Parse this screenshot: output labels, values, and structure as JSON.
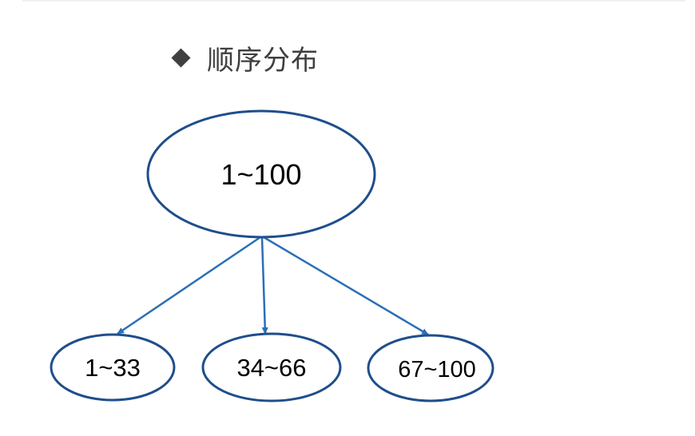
{
  "title": "顺序分布",
  "diagram": {
    "root": {
      "label": "1~100"
    },
    "children": [
      {
        "label": "1~33"
      },
      {
        "label": "34~66"
      },
      {
        "label": "67~100"
      }
    ],
    "colors": {
      "node_stroke": "#1f4e8c",
      "edge": "#2a6fb8"
    }
  }
}
